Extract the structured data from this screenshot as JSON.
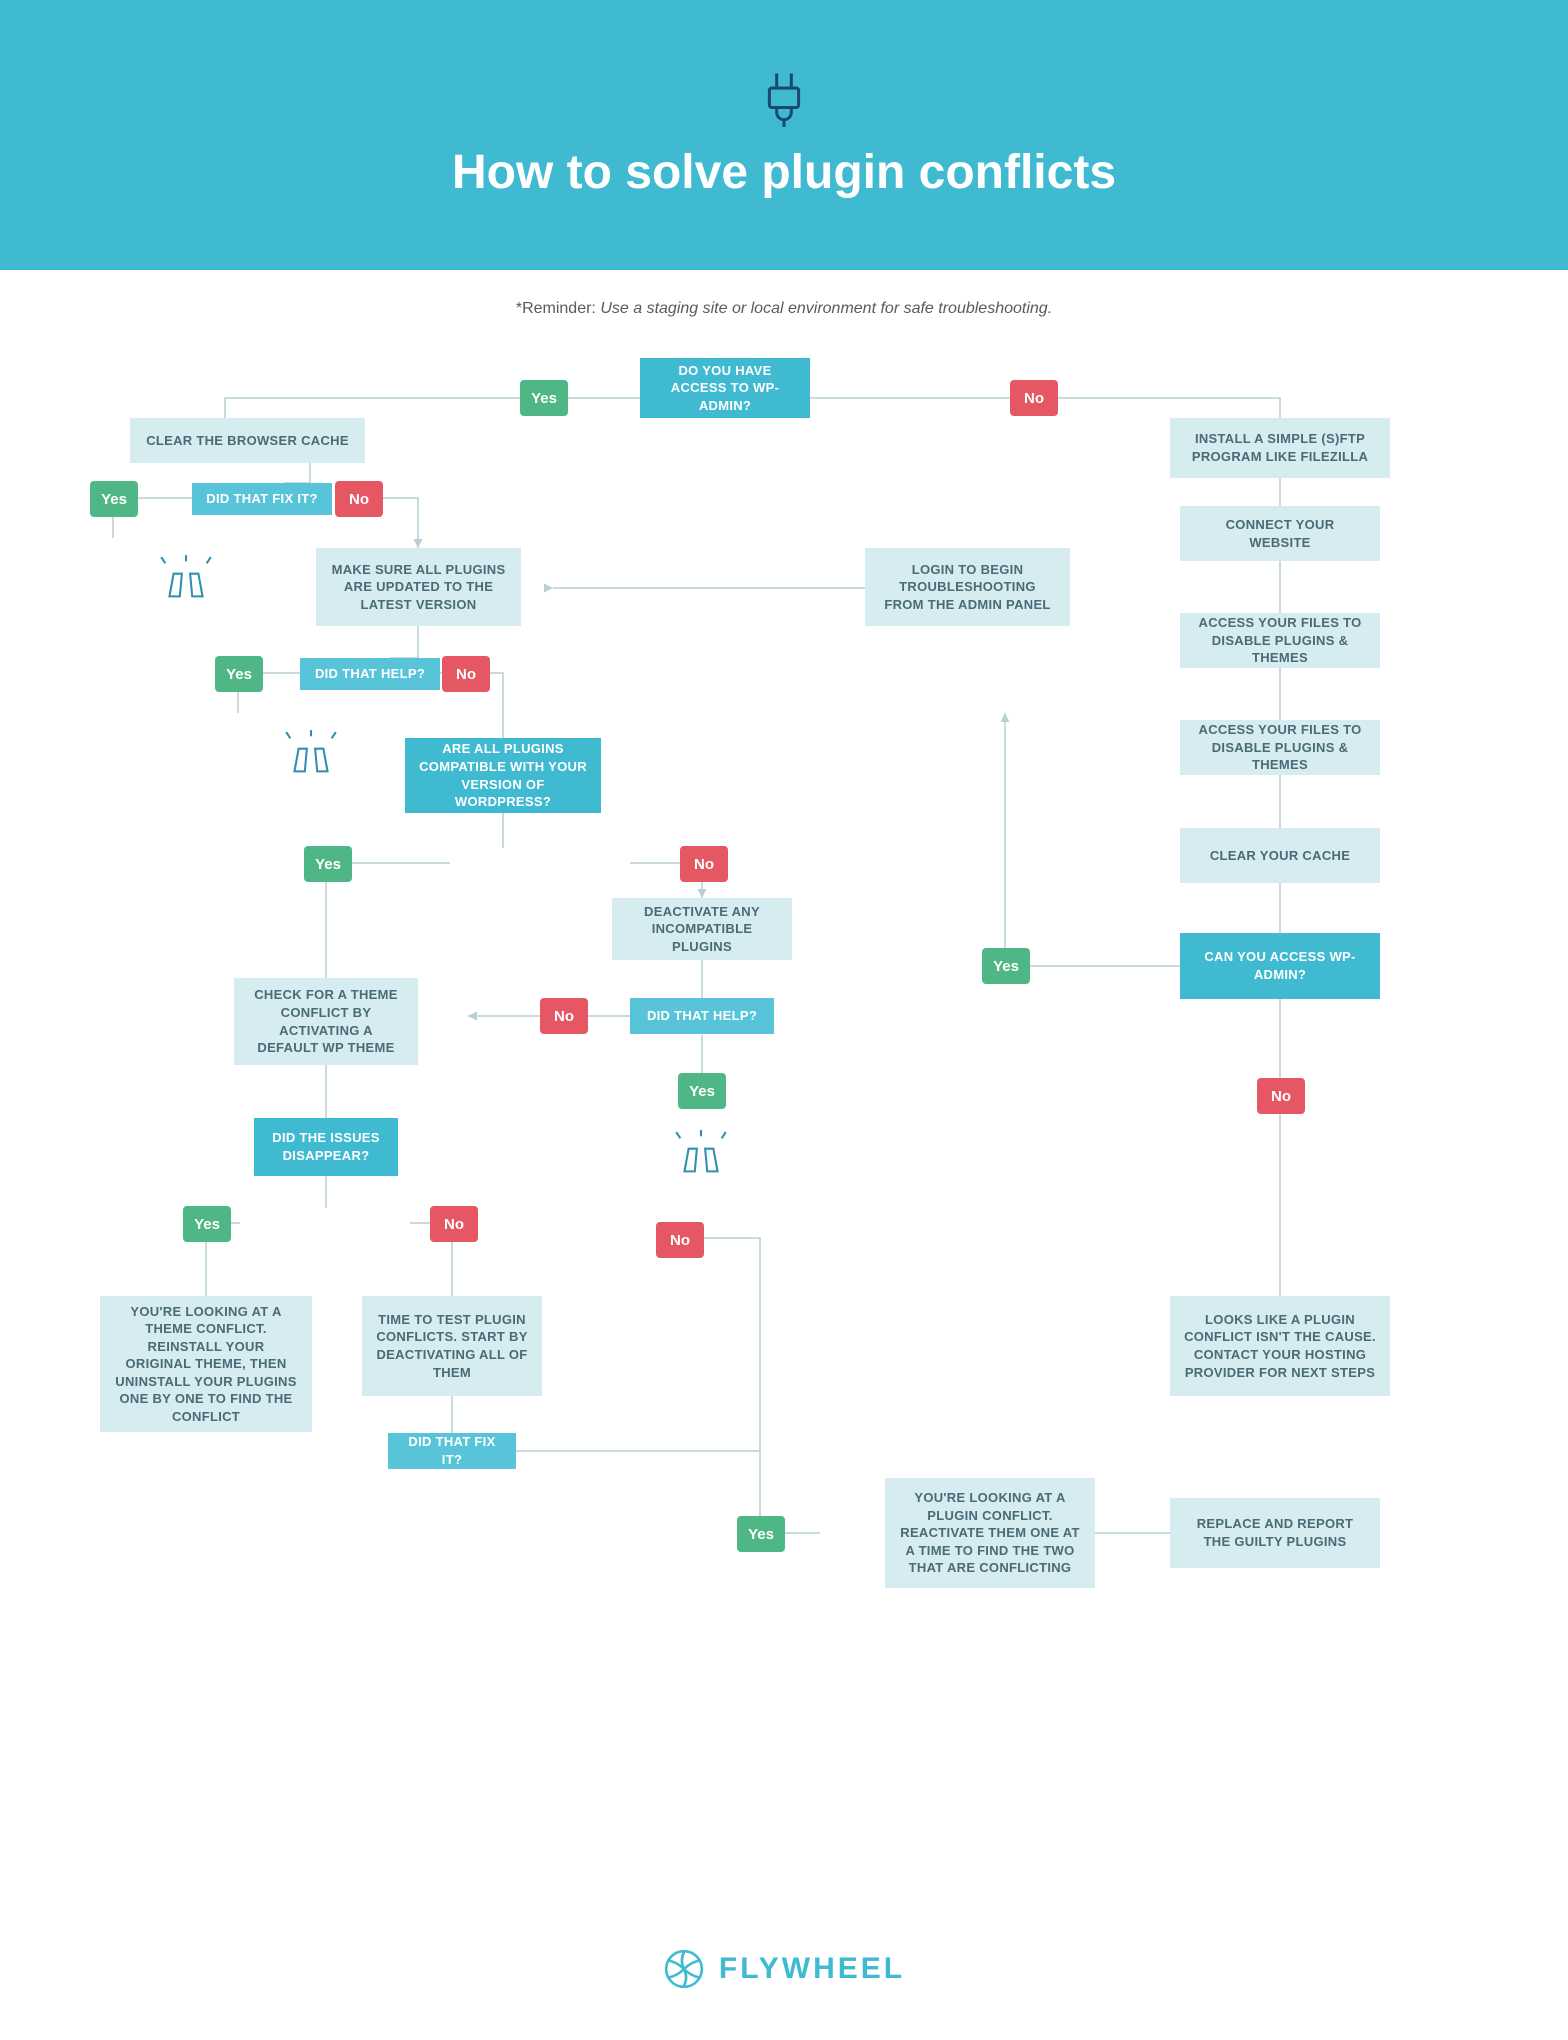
{
  "header": {
    "title": "How to solve plugin conflicts"
  },
  "reminder": {
    "label": "*Reminder:",
    "text": "Use a staging site or local environment for safe troubleshooting."
  },
  "labels": {
    "yes": "Yes",
    "no": "No"
  },
  "nodes": {
    "q_access": "DO YOU HAVE ACCESS TO WP-ADMIN?",
    "clear_cache": "CLEAR THE BROWSER CACHE",
    "install_sftp": "INSTALL A SIMPLE (S)FTP PROGRAM LIKE FILEZILLA",
    "fix1": "DID THAT FIX IT?",
    "update_plugins": "MAKE SURE ALL PLUGINS ARE UPDATED TO THE LATEST VERSION",
    "login_admin": "LOGIN TO BEGIN TROUBLESHOOTING FROM THE ADMIN PANEL",
    "connect_site": "CONNECT YOUR WEBSITE",
    "help1": "DID THAT HELP?",
    "access_files1": "ACCESS YOUR FILES TO DISABLE PLUGINS & THEMES",
    "all_compatible": "ARE ALL PLUGINS COMPATIBLE WITH YOUR VERSION OF WORDPRESS?",
    "access_files2": "ACCESS YOUR FILES TO DISABLE PLUGINS & THEMES",
    "deactivate_incompat": "DEACTIVATE ANY INCOMPATIBLE PLUGINS",
    "clear_cache2": "CLEAR YOUR CACHE",
    "help2": "DID THAT HELP?",
    "can_access": "CAN YOU ACCESS WP-ADMIN?",
    "theme_check": "CHECK FOR A THEME CONFLICT BY ACTIVATING A DEFAULT WP THEME",
    "issues_gone": "DID THE ISSUES DISAPPEAR?",
    "theme_conflict": "YOU'RE LOOKING AT A THEME CONFLICT. REINSTALL YOUR ORIGINAL THEME, THEN UNINSTALL YOUR PLUGINS ONE BY ONE TO FIND THE CONFLICT",
    "test_plugins": "TIME TO TEST PLUGIN CONFLICTS. START BY DEACTIVATING ALL OF THEM",
    "not_plugin": "LOOKS LIKE A PLUGIN CONFLICT ISN'T THE CAUSE. CONTACT YOUR HOSTING PROVIDER FOR NEXT STEPS",
    "fix2": "DID THAT FIX IT?",
    "plugin_conflict": "YOU'RE LOOKING AT A PLUGIN CONFLICT. REACTIVATE THEM ONE AT A TIME TO FIND THE TWO THAT ARE CONFLICTING",
    "replace_report": "REPLACE AND REPORT THE GUILTY PLUGINS"
  },
  "footer": {
    "brand": "FLYWHEEL"
  }
}
